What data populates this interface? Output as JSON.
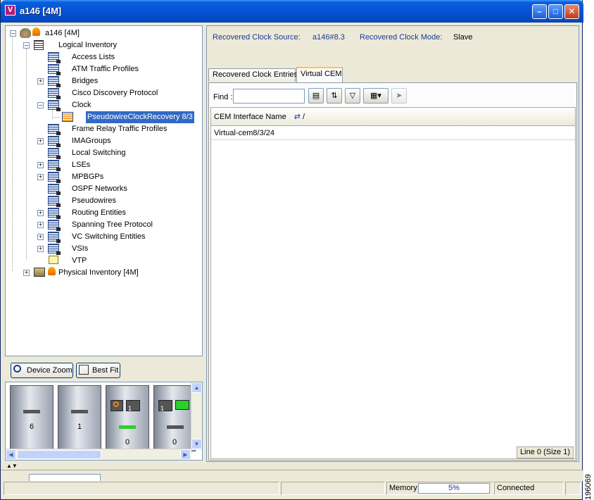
{
  "window": {
    "title": "a146 [4M]",
    "app_icon_letter": "V"
  },
  "tree": {
    "root": "a146 [4M]",
    "logical": "Logical Inventory",
    "items": [
      {
        "label": "Access Lists",
        "expandable": false
      },
      {
        "label": "ATM Traffic Profiles",
        "expandable": false
      },
      {
        "label": "Bridges",
        "expandable": true
      },
      {
        "label": "Cisco Discovery Protocol",
        "expandable": false
      },
      {
        "label": "Clock",
        "expandable": true,
        "expanded": true
      },
      {
        "label": "PseudowireClockRecovery 8/3",
        "child": true,
        "selected": true
      },
      {
        "label": "Frame Relay Traffic Profiles",
        "expandable": false
      },
      {
        "label": "IMAGroups",
        "expandable": true
      },
      {
        "label": "Local Switching",
        "expandable": false
      },
      {
        "label": "LSEs",
        "expandable": true
      },
      {
        "label": "MPBGPs",
        "expandable": true
      },
      {
        "label": "OSPF Networks",
        "expandable": false
      },
      {
        "label": "Pseudowires",
        "expandable": false
      },
      {
        "label": "Routing Entities",
        "expandable": true
      },
      {
        "label": "Spanning Tree Protocol",
        "expandable": true
      },
      {
        "label": "VC Switching Entities",
        "expandable": true
      },
      {
        "label": "VSIs",
        "expandable": true
      },
      {
        "label": "VTP",
        "expandable": false
      }
    ],
    "physical": "Physical Inventory [4M]"
  },
  "zoom": {
    "device_zoom": "Device Zoom",
    "best_fit": "Best Fit"
  },
  "device_view": {
    "cards": [
      "6",
      "1",
      "0",
      "0"
    ],
    "port_labels": [
      "1",
      "1"
    ]
  },
  "details": {
    "source_label": "Recovered Clock Source:",
    "source_value": "a146#8.3",
    "mode_label": "Recovered Clock Mode:",
    "mode_value": "Slave"
  },
  "tabs": {
    "entries": "Recovered Clock Entries",
    "virtual_cem": "Virtual CEM"
  },
  "find": {
    "label": "Find :",
    "value": ""
  },
  "table": {
    "column": "CEM Interface Name",
    "sort_marker": "/",
    "rows": [
      "Virtual-cem8/3/24"
    ],
    "status": "Line 0 (Size 1)"
  },
  "status_bar": {
    "memory_label": "Memory:",
    "memory_value": "5%",
    "connection": "Connected"
  },
  "side_code": "196069",
  "colors": {
    "title_bar": "#0454d6",
    "selection": "#316ac5",
    "label_blue": "#1c3a90",
    "tab_highlight": "#ffc83c"
  }
}
